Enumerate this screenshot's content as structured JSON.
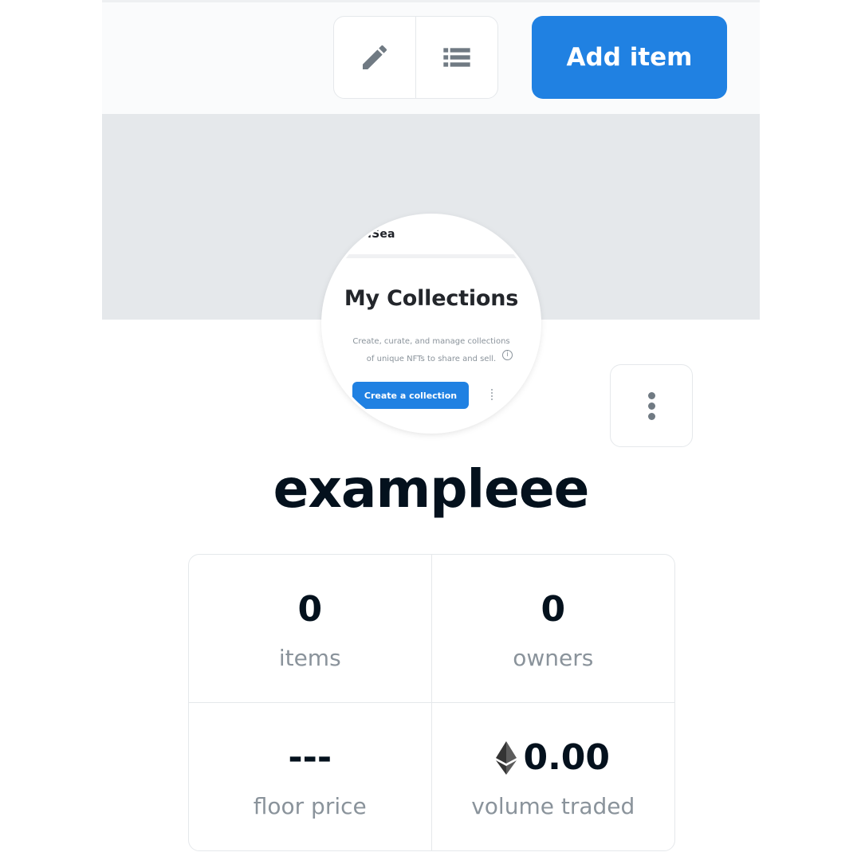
{
  "toolbar": {
    "add_item_label": "Add item"
  },
  "avatar": {
    "brand": "penSea",
    "title": "My Collections",
    "description_line1": "Create, curate, and manage collections",
    "description_line2": "of unique NFTs to share and sell.",
    "cta_label": "Create a collection"
  },
  "collection": {
    "name": "exampleee"
  },
  "stats": [
    {
      "value": "0",
      "label": "items"
    },
    {
      "value": "0",
      "label": "owners"
    },
    {
      "value": "---",
      "label": "floor price"
    },
    {
      "value": "0.00",
      "label": "volume traded",
      "currency_icon": "ethereum-icon"
    }
  ],
  "colors": {
    "accent": "#2081e2",
    "banner": "#e5e8eb",
    "text_primary": "#04111d",
    "text_secondary": "#8a939b"
  }
}
